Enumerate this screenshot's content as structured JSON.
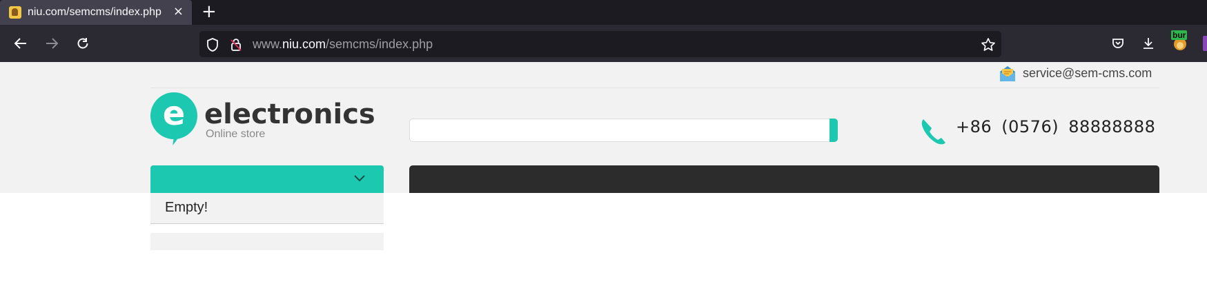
{
  "browser": {
    "tab": {
      "title": "niu.com/semcms/index.php",
      "close_glyph": "×",
      "favicon": "page-favicon"
    },
    "new_tab_glyph": "+",
    "nav": {
      "back_icon": "arrow-left-icon",
      "forward_icon": "arrow-right-icon",
      "reload_icon": "reload-icon"
    },
    "url": {
      "prefix": "www.",
      "host": "niu.com",
      "path": "/semcms/index.php"
    },
    "toolbar_icons": [
      "shield-icon",
      "insecure-lock-icon",
      "bookmark-star-icon",
      "pocket-icon",
      "download-icon",
      "extension-avatar-icon"
    ],
    "extension_badge": "bur"
  },
  "site": {
    "contact_email": "service@sem-cms.com",
    "logo_letter": "e",
    "brand_name": "electronics",
    "brand_tagline": "Online store",
    "search_placeholder": "",
    "phone": "+86 (0576) 88888888",
    "categories": {
      "dropdown_items": [
        "Empty!"
      ]
    },
    "colors": {
      "accent": "#1cc8b0",
      "banner": "#2c2c2c",
      "header_bg": "#f2f2f2"
    }
  }
}
